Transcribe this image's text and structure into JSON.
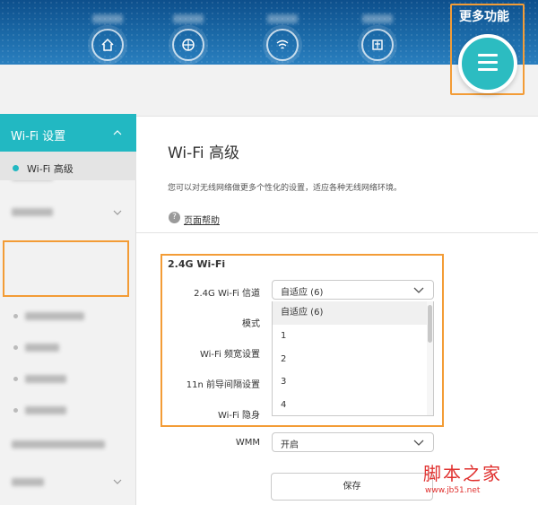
{
  "header": {
    "nav_items": [
      {
        "label": "",
        "icon": "home-icon"
      },
      {
        "label": "",
        "icon": "globe-icon"
      },
      {
        "label": "",
        "icon": "wifi-icon"
      },
      {
        "label": "",
        "icon": "device-icon"
      }
    ],
    "more_label": "更多功能",
    "more_icon": "menu-icon"
  },
  "sidebar": {
    "wifi_settings_label": "Wi-Fi 设置",
    "wifi_advanced_label": "Wi-Fi 高级"
  },
  "main": {
    "title": "Wi-Fi 高级",
    "description": "您可以对无线网络做更多个性化的设置，适应各种无线网络环境。",
    "help_label": "页面帮助",
    "section_title": "2.4G Wi-Fi",
    "fields": {
      "channel_label": "2.4G Wi-Fi 信道",
      "channel_value": "自适应 (6)",
      "mode_label": "模式",
      "bandwidth_label": "Wi-Fi 频宽设置",
      "guard_label": "11n 前导间隔设置",
      "hidden_label": "Wi-Fi 隐身",
      "wmm_label": "WMM",
      "wmm_value": "开启"
    },
    "channel_options": [
      "自适应 (6)",
      "1",
      "2",
      "3",
      "4"
    ],
    "save_label": "保存"
  },
  "watermark": {
    "title": "脚本之家",
    "url": "www.jb51.net"
  },
  "colors": {
    "accent": "#22b8c2",
    "highlight_box": "#f39c36",
    "banner": "#1b6aa8"
  }
}
